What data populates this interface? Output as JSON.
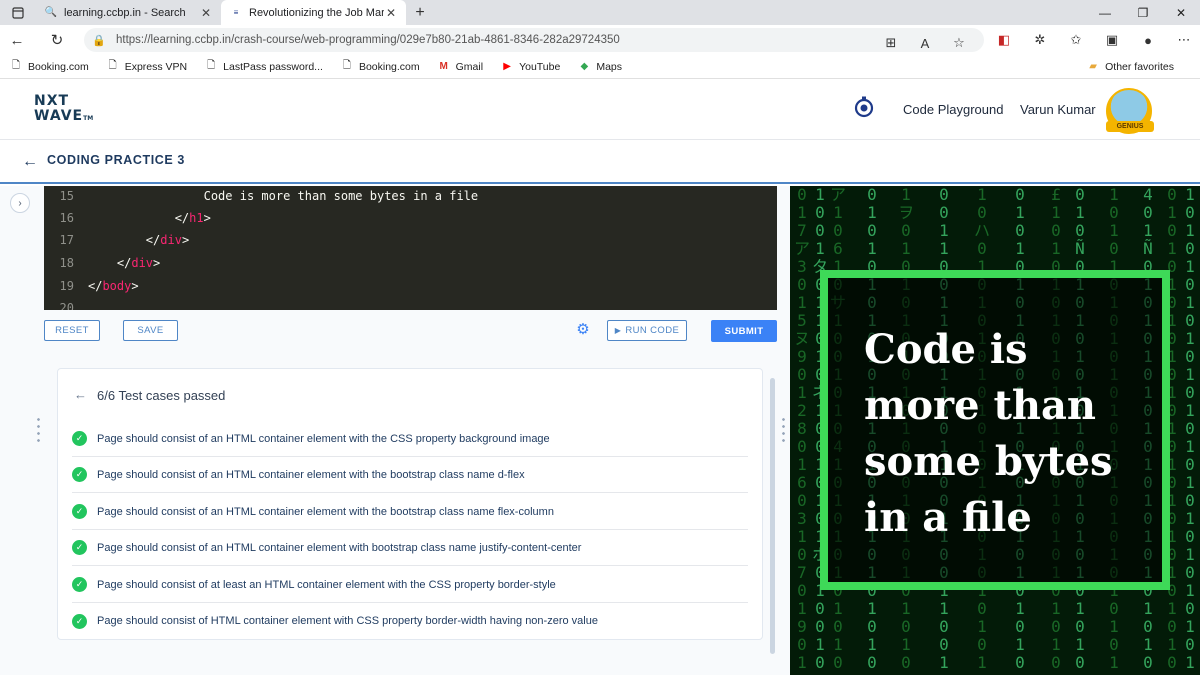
{
  "browser": {
    "tabs": [
      {
        "title": "learning.ccbp.in - Search",
        "active": false
      },
      {
        "title": "Revolutionizing the Job Market |",
        "active": true
      }
    ],
    "url": "https://learning.ccbp.in/crash-course/web-programming/029e7b80-21ab-4861-8346-282a29724350",
    "bookmarks": [
      "Booking.com",
      "Express VPN",
      "LastPass password...",
      "Booking.com",
      "Gmail",
      "YouTube",
      "Maps"
    ],
    "other_favorites": "Other favorites"
  },
  "header": {
    "logo_line1": "NXT",
    "logo_line2": "WAVE",
    "logo_tm": "TM",
    "code_playground": "Code Playground",
    "user_name": "Varun Kumar",
    "badge": "GENIUS"
  },
  "practice": {
    "title": "CODING PRACTICE 3"
  },
  "editor": {
    "lines": [
      {
        "num": "15",
        "indent": "                ",
        "text": "Code is more than some bytes in a file",
        "tag": ""
      },
      {
        "num": "16",
        "indent": "            ",
        "text": "</",
        "tag": "h1",
        "close": ">"
      },
      {
        "num": "17",
        "indent": "        ",
        "text": "</",
        "tag": "div",
        "close": ">"
      },
      {
        "num": "18",
        "indent": "    ",
        "text": "</",
        "tag": "div",
        "close": ">"
      },
      {
        "num": "19",
        "indent": "",
        "text": "</",
        "tag": "body",
        "close": ">"
      },
      {
        "num": "20",
        "indent": "",
        "text": "",
        "tag": ""
      }
    ]
  },
  "toolbar": {
    "reset": "RESET",
    "save": "SAVE",
    "run": "RUN CODE",
    "submit": "SUBMIT"
  },
  "results": {
    "summary": "6/6 Test cases passed",
    "tests": [
      "Page should consist of an HTML container element with the CSS property background image",
      "Page should consist of an HTML container element with the bootstrap class name d-flex",
      "Page should consist of an HTML container element with the bootstrap class name flex-column",
      "Page should consist of an HTML container element with bootstrap class name justify-content-center",
      "Page should consist of at least an HTML container element with the CSS property border-style",
      "Page should consist of HTML container element with CSS property border-width having non-zero value"
    ]
  },
  "preview": {
    "text": "Code is more than some bytes in a file",
    "border_color": "#3ed958"
  }
}
